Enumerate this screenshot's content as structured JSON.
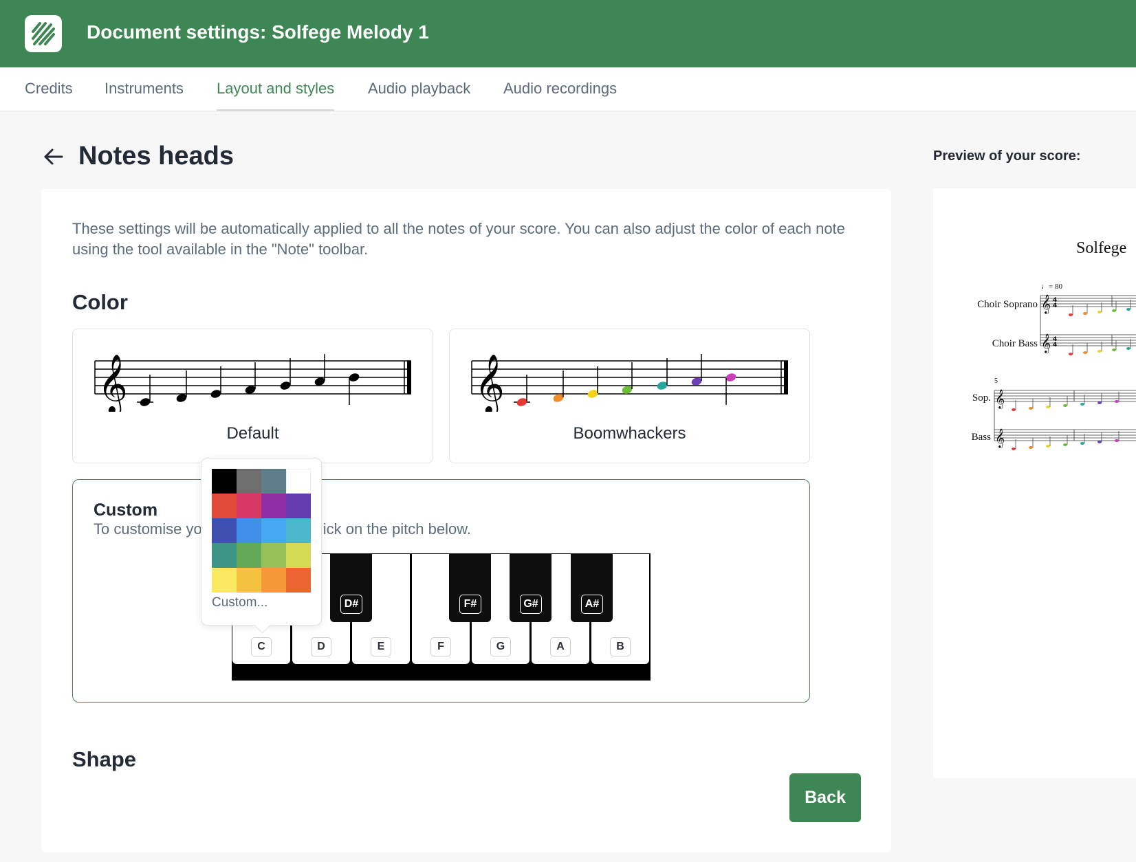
{
  "header": {
    "title": "Document settings: Solfege Melody 1",
    "brand_color": "#3e8653"
  },
  "tabs": [
    {
      "label": "Credits",
      "active": false
    },
    {
      "label": "Instruments",
      "active": false
    },
    {
      "label": "Layout and styles",
      "active": true
    },
    {
      "label": "Audio playback",
      "active": false
    },
    {
      "label": "Audio recordings",
      "active": false
    }
  ],
  "section": {
    "title": "Notes heads",
    "description": "These settings will be automatically applied to all the notes of your score. You can also adjust the color of each note using the tool available in the \"Note\" toolbar.",
    "color_heading": "Color",
    "shape_heading": "Shape"
  },
  "color_options": [
    {
      "label": "Default",
      "note_colors": [
        "#000000",
        "#000000",
        "#000000",
        "#000000",
        "#000000",
        "#000000",
        "#000000"
      ]
    },
    {
      "label": "Boomwhackers",
      "note_colors": [
        "#e53935",
        "#f28c28",
        "#f2d21b",
        "#6fbf3a",
        "#26a69a",
        "#6a3fb8",
        "#c83fb8"
      ]
    }
  ],
  "custom": {
    "title": "Custom",
    "subtitle_visible_left": "To customise yo",
    "subtitle_visible_right": "ick on the pitch below.",
    "white_keys": [
      "C",
      "D",
      "E",
      "F",
      "G",
      "A",
      "B"
    ],
    "black_keys": [
      "D#",
      "F#",
      "G#",
      "A#"
    ]
  },
  "color_picker": {
    "swatches": [
      "#000000",
      "#6e6e6e",
      "#607d8b",
      "#ffffff",
      "#e04b3a",
      "#d63964",
      "#8e2fa6",
      "#643cb0",
      "#3f4fb0",
      "#3f8fe8",
      "#46a8f0",
      "#4ab8cc",
      "#3d9485",
      "#62aa57",
      "#96c058",
      "#d1da52",
      "#fce962",
      "#f5c240",
      "#f39937",
      "#ec6634"
    ],
    "custom_label": "Custom..."
  },
  "actions": {
    "back_label": "Back"
  },
  "preview": {
    "title": "Preview of your score:",
    "score_title": "Solfege",
    "tempo": "= 80",
    "instruments_system1": [
      "Choir Soprano",
      "Choir Bass"
    ],
    "instruments_system2": [
      "Sop.",
      "Bass"
    ],
    "measure_number": "5"
  }
}
